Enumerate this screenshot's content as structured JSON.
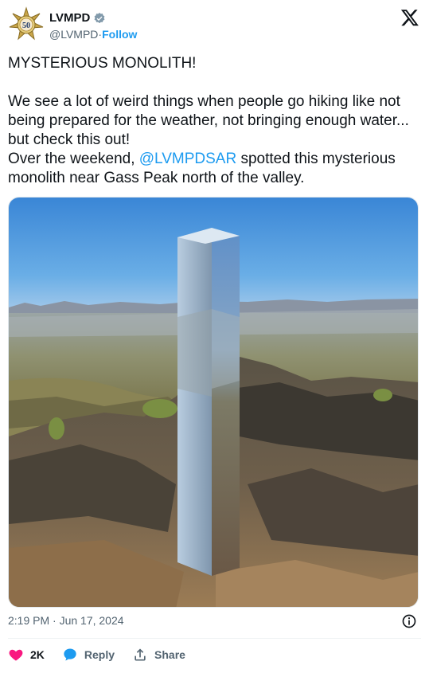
{
  "author": {
    "display_name": "LVMPD",
    "handle": "@LVMPD",
    "follow_label": "Follow",
    "separator": " · ",
    "badge_number": "50"
  },
  "tweet": {
    "line1": "MYSTERIOUS MONOLITH!",
    "line2": "We see a lot of weird things when people go hiking like not being prepared for the weather, not bringing enough water... but check this out!",
    "line3_prefix": "Over the weekend, ",
    "mention": "@LVMPDSAR",
    "line3_suffix": " spotted this mysterious monolith near Gass Peak north of the valley."
  },
  "meta": {
    "timestamp": "2:19 PM · Jun 17, 2024"
  },
  "actions": {
    "like_count": "2K",
    "reply_label": "Reply",
    "share_label": "Share"
  },
  "colors": {
    "link": "#1d9bf0",
    "heart": "#f91880",
    "muted": "#536471"
  },
  "icons": [
    "star-badge-avatar",
    "verified-icon",
    "x-logo-icon",
    "info-icon",
    "heart-icon",
    "reply-icon",
    "share-icon"
  ]
}
